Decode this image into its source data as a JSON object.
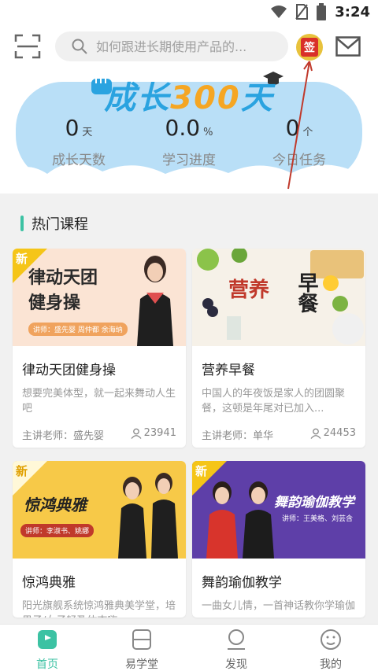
{
  "status_bar": {
    "time": "3:24"
  },
  "search": {
    "placeholder": "如何跟进长期使用产品的..."
  },
  "sign_in": {
    "label": "签"
  },
  "banner": {
    "title_part1": "成长",
    "title_part2": "300",
    "title_part3": "天",
    "stats": [
      {
        "value": "0",
        "unit": "天",
        "label": "成长天数"
      },
      {
        "value": "0.0",
        "unit": "%",
        "label": "学习进度"
      },
      {
        "value": "0",
        "unit": "个",
        "label": "今日任务"
      }
    ]
  },
  "section": {
    "title": "热门课程"
  },
  "courses": [
    {
      "image_title_1": "律动天团",
      "image_title_2": "健身操",
      "image_lecturers": "讲师：盛先婴   周仲都   余海纳",
      "badge": "新",
      "title": "律动天团健身操",
      "desc": "想要完美体型，就一起来舞动人生吧",
      "teacher": "主讲老师：盛先婴",
      "count": "23941"
    },
    {
      "image_title_1": "营养",
      "image_title_2": "早餐",
      "title": "营养早餐",
      "desc": "中国人的年夜饭是家人的团圆聚餐，这顿是年尾对已加入...",
      "teacher": "主讲老师：单华",
      "count": "24453"
    },
    {
      "image_title_1": "惊鸿典雅",
      "image_lecturers": "讲师：李淑书、姚娜",
      "badge": "新",
      "title": "惊鸿典雅",
      "desc": "阳光旗舰系统惊鸿雅典美学堂，培男子/女子轻盈体态嗨"
    },
    {
      "image_title_1": "舞韵瑜伽教学",
      "image_lecturers": "讲师：王美格、刘芸含",
      "badge": "新",
      "title": "舞韵瑜伽教学",
      "desc": "一曲女儿情，一首神话教你学瑜伽"
    }
  ],
  "tabbar": [
    {
      "label": "首页",
      "active": true
    },
    {
      "label": "易学堂",
      "active": false
    },
    {
      "label": "发现",
      "active": false
    },
    {
      "label": "我的",
      "active": false
    }
  ],
  "colors": {
    "accent": "#3cc2a3",
    "sign_red": "#d9302a",
    "sign_gold": "#e8c23c",
    "banner_sky": "#b9dff7"
  }
}
